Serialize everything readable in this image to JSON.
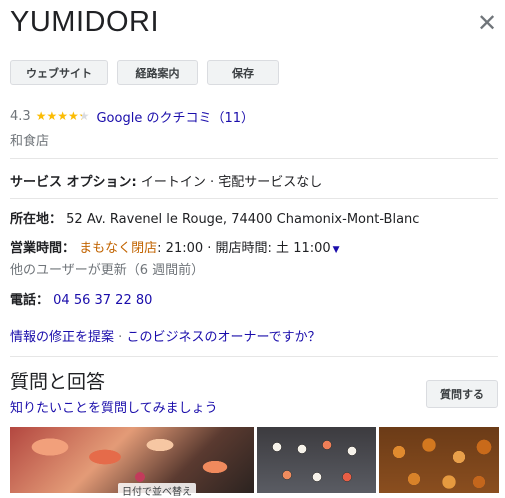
{
  "place": {
    "name": "YUMIDORI"
  },
  "actions": {
    "website": "ウェブサイト",
    "directions": "経路案内",
    "save": "保存"
  },
  "rating": {
    "value": "4.3",
    "stars": 4.3,
    "reviews_link": "Google のクチコミ（11）"
  },
  "category": "和食店",
  "service_options": {
    "label": "サービス オプション:",
    "value": "イートイン · 宅配サービスなし"
  },
  "address": {
    "label": "所在地：",
    "value": "52 Av. Ravenel le Rouge, 74400 Chamonix-Mont-Blanc"
  },
  "hours": {
    "label": "営業時間：",
    "status": "まもなく閉店",
    "closing": ": 21:00 · 開店時間: 土 11:00",
    "update_note": "他のユーザーが更新（6 週間前）"
  },
  "phone": {
    "label": "電話：",
    "value": "04 56 37 22 80"
  },
  "links": {
    "suggest_edit": "情報の修正を提案",
    "separator": "·",
    "own_business": "このビジネスのオーナーですか？"
  },
  "qa": {
    "title": "質問と回答",
    "ask_link": "知りたいことを質問してみましょう",
    "ask_button": "質問する"
  },
  "photos": {
    "overlay_label": "日付で並べ替え"
  },
  "colors": {
    "link": "#1a0dab",
    "status_orange": "#c26401",
    "star": "#fbbc04",
    "muted": "#70757a"
  }
}
